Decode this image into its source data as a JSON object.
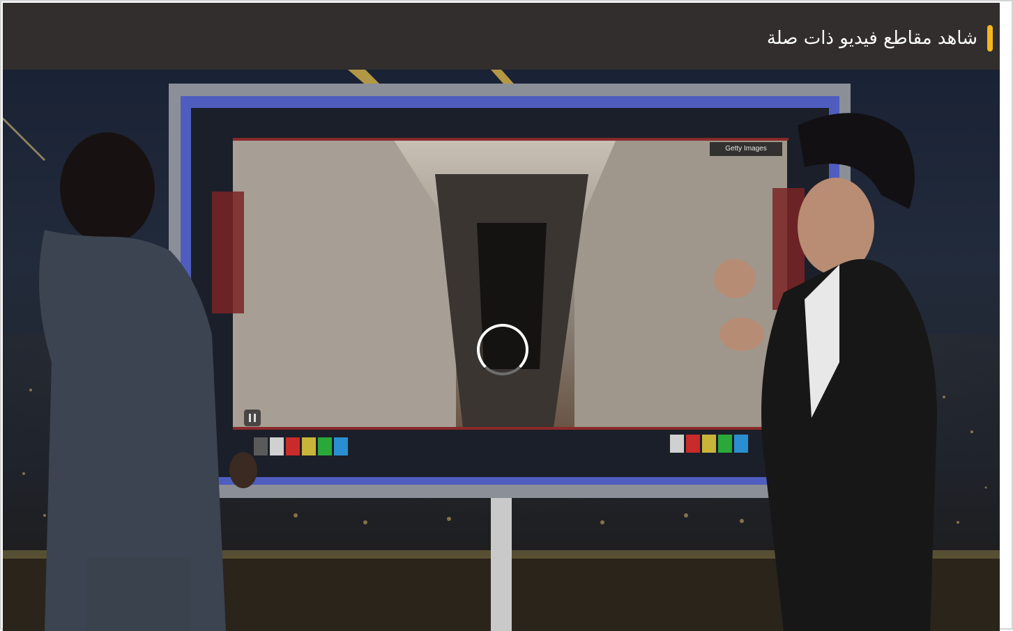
{
  "header": {
    "title": "شاهد مقاطع فيديو ذات صلة"
  },
  "video": {
    "watermark": "Getty Images",
    "state": "loading",
    "icons": {
      "loading": "loading-spinner-icon",
      "pause": "pause-icon"
    }
  },
  "colors": {
    "header_bg": "#312e2d",
    "accent": "#f5b61e",
    "title": "#ffffff"
  }
}
